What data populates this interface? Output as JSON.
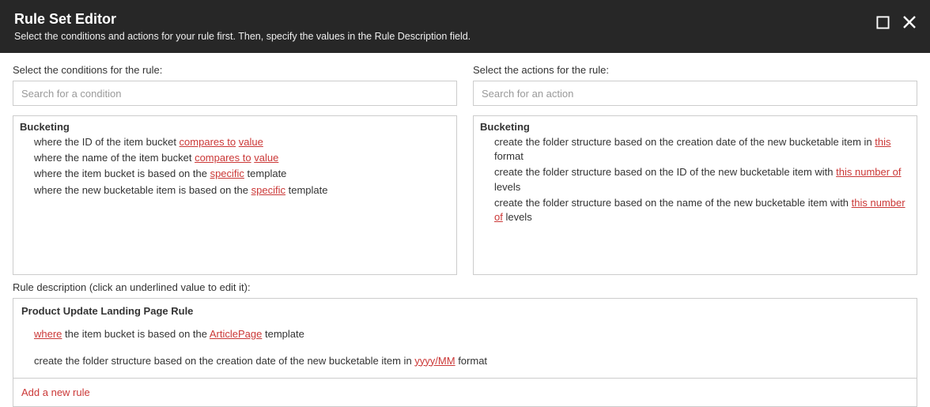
{
  "header": {
    "title": "Rule Set Editor",
    "subtitle": "Select the conditions and actions for your rule first. Then, specify the values in the Rule Description field."
  },
  "conditions": {
    "label": "Select the conditions for the rule:",
    "placeholder": "Search for a condition",
    "group": "Bucketing",
    "items": [
      {
        "pre": "where the ID of the item bucket ",
        "l1": "compares to",
        "mid": " ",
        "l2": "value",
        "post": ""
      },
      {
        "pre": "where the name of the item bucket ",
        "l1": "compares to",
        "mid": " ",
        "l2": "value",
        "post": ""
      },
      {
        "pre": "where the item bucket is based on the ",
        "l1": "specific",
        "mid": "",
        "l2": "",
        "post": " template"
      },
      {
        "pre": "where the new bucketable item is based on the ",
        "l1": "specific",
        "mid": "",
        "l2": "",
        "post": " template"
      }
    ]
  },
  "actions": {
    "label": "Select the actions for the rule:",
    "placeholder": "Search for an action",
    "group": "Bucketing",
    "items": [
      {
        "pre": "create the folder structure based on the creation date of the new bucketable item in ",
        "l1": "this",
        "mid": "",
        "l2": "",
        "post": " format"
      },
      {
        "pre": "create the folder structure based on the ID of the new bucketable item with ",
        "l1": "this number of",
        "mid": "",
        "l2": "",
        "post": " levels"
      },
      {
        "pre": "create the folder structure based on the name of the new bucketable item with ",
        "l1": "this number of",
        "mid": "",
        "l2": "",
        "post": " levels"
      }
    ]
  },
  "description": {
    "label": "Rule description (click an underlined value to edit it):",
    "rule_name": "Product Update Landing Page Rule",
    "lines": [
      {
        "pre": "",
        "l1": "where",
        "mid": " the item bucket is based on the ",
        "l2": "ArticlePage",
        "post": " template"
      },
      {
        "pre": "create the folder structure based on the creation date of the new bucketable item in ",
        "l1": "yyyy/MM",
        "mid": "",
        "l2": "",
        "post": " format"
      }
    ],
    "add_rule": "Add a new rule"
  }
}
